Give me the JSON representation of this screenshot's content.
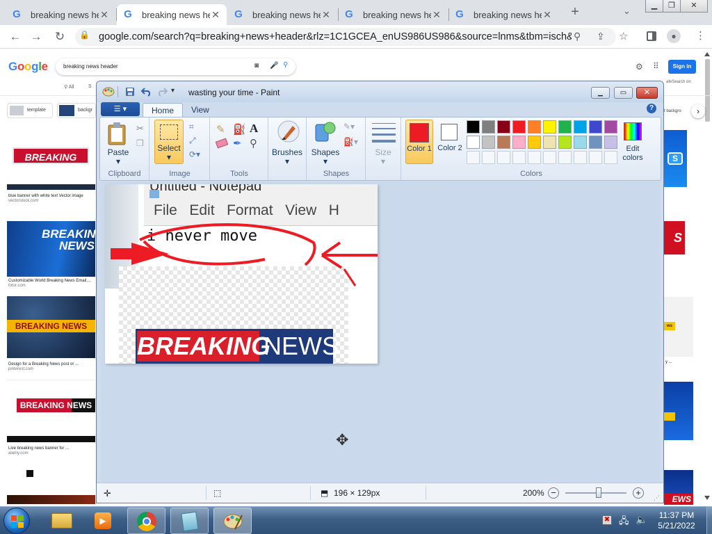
{
  "browser": {
    "tabs": [
      {
        "title": "breaking news he",
        "active": false
      },
      {
        "title": "breaking news he",
        "active": true
      },
      {
        "title": "breaking news he",
        "active": false
      },
      {
        "title": "breaking news he",
        "active": false
      },
      {
        "title": "breaking news he",
        "active": false
      }
    ],
    "new_tab": "+",
    "address": "google.com/search?q=breaking+news+header&rlz=1C1GCEA_enUS986US986&source=lnms&tbm=isch&s..."
  },
  "google": {
    "logo": "Google",
    "query": "breaking news header",
    "sign_in": "Sign in",
    "filters": [
      "All",
      "S"
    ],
    "chips": [
      "template",
      "backgr",
      "t backgro"
    ],
    "safe_search": "afeSearch on",
    "results": [
      {
        "banner": "BREAKING NEWS",
        "caption": "blue banner with white text Vector image",
        "source": "vectorstock.com"
      },
      {
        "banner": "BREAKING NEWS",
        "caption": "Customizable World Breaking News Email ...",
        "source": "fotor.com"
      },
      {
        "banner": "BREAKING NEWS",
        "caption": "Design for a Breaking News post or ...",
        "source": "pinterest.com"
      },
      {
        "banner": "BREAKING NEWS",
        "caption": "Live breaking news banner for ...",
        "source": "alamy.com"
      }
    ],
    "right_captions": [
      "y ...",
      "ws"
    ]
  },
  "paint": {
    "title": "wasting your time - Paint",
    "tabs": [
      "Home",
      "View"
    ],
    "groups": {
      "clipboard": {
        "label": "Clipboard",
        "paste": "Paste"
      },
      "image": {
        "label": "Image",
        "select": "Select"
      },
      "tools": {
        "label": "Tools"
      },
      "brushes": {
        "label": "Brushes"
      },
      "shapes": {
        "label": "Shapes",
        "shapes_btn": "Shapes"
      },
      "size": {
        "label": "Size"
      },
      "colors": {
        "label": "Colors",
        "color1": "Color 1",
        "color2": "Color 2",
        "edit": "Edit colors",
        "color1_value": "#ed1c24",
        "color2_value": "#ffffff",
        "palette_row1": [
          "#000000",
          "#7f7f7f",
          "#880015",
          "#ed1c24",
          "#ff7f27",
          "#fff200",
          "#22b14c",
          "#00a2e8",
          "#3f48cc",
          "#a349a4"
        ],
        "palette_row2": [
          "#ffffff",
          "#c3c3c3",
          "#b97a57",
          "#ffaec9",
          "#ffc90e",
          "#efe4b0",
          "#b5e61d",
          "#99d9ea",
          "#7092be",
          "#c8bfe7"
        ]
      }
    },
    "canvas": {
      "notepad_title": "Untitled - Notepad",
      "notepad_menu": [
        "File",
        "Edit",
        "Format",
        "View",
        "H"
      ],
      "handwritten_text": "i never move",
      "banner_left": "BREAKING",
      "banner_right": "NEWS"
    },
    "status": {
      "image_size": "196 × 129px",
      "zoom": "200%"
    }
  },
  "taskbar": {
    "time": "11:37 PM",
    "date": "5/21/2022"
  }
}
